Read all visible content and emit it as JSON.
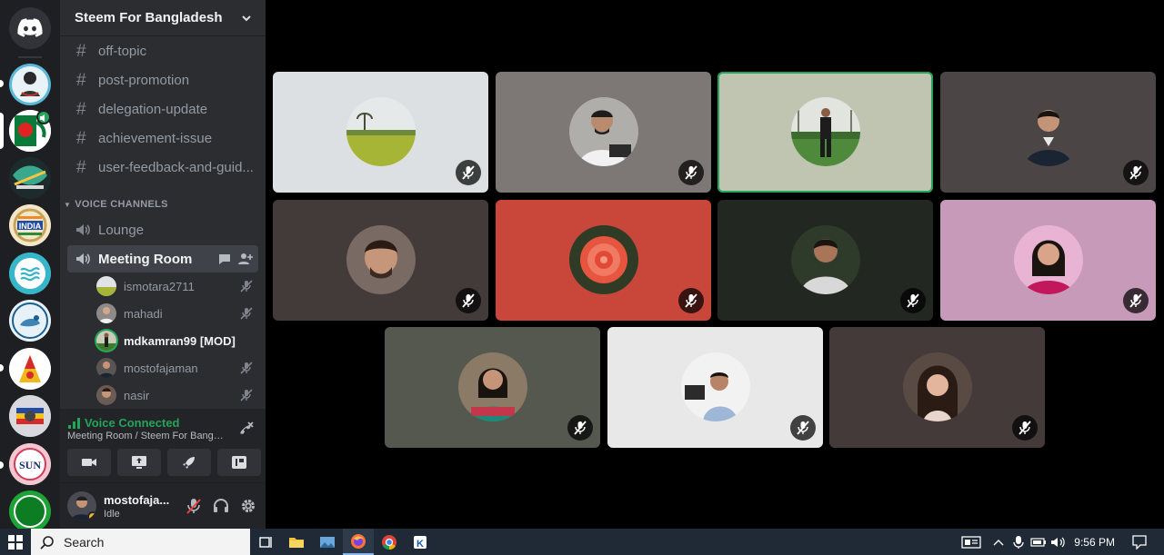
{
  "server": {
    "name": "Steem For Bangladesh"
  },
  "text_channels": [
    "off-topic",
    "post-promotion",
    "delegation-update",
    "achievement-issue",
    "user-feedback-and-guid..."
  ],
  "voice_category": "VOICE CHANNELS",
  "voice_channels": {
    "lounge": "Lounge",
    "meeting_room": "Meeting Room"
  },
  "voice_users": [
    "ismotara2711",
    "mahadi",
    "mdkamran99 [MOD]",
    "mostofajaman",
    "nasir"
  ],
  "voice_connected": {
    "status": "Voice Connected",
    "location": "Meeting Room / Steem For Bangl..."
  },
  "user_panel": {
    "username": "mostofaja...",
    "status": "Idle"
  },
  "taskbar": {
    "search_placeholder": "Search",
    "time": "9:56 PM"
  },
  "colors": {
    "speaking": "#23a55a",
    "tile_colors": [
      "#dce0e3",
      "#7d7775",
      "#c0c5b2",
      "#4b4645",
      "#433b3a",
      "#c9463b",
      "#232721",
      "#c89ab9",
      "#55584f",
      "#e8e8e8",
      "#433a39"
    ]
  },
  "icons": {
    "tile_status": "mic-muted-icon"
  }
}
